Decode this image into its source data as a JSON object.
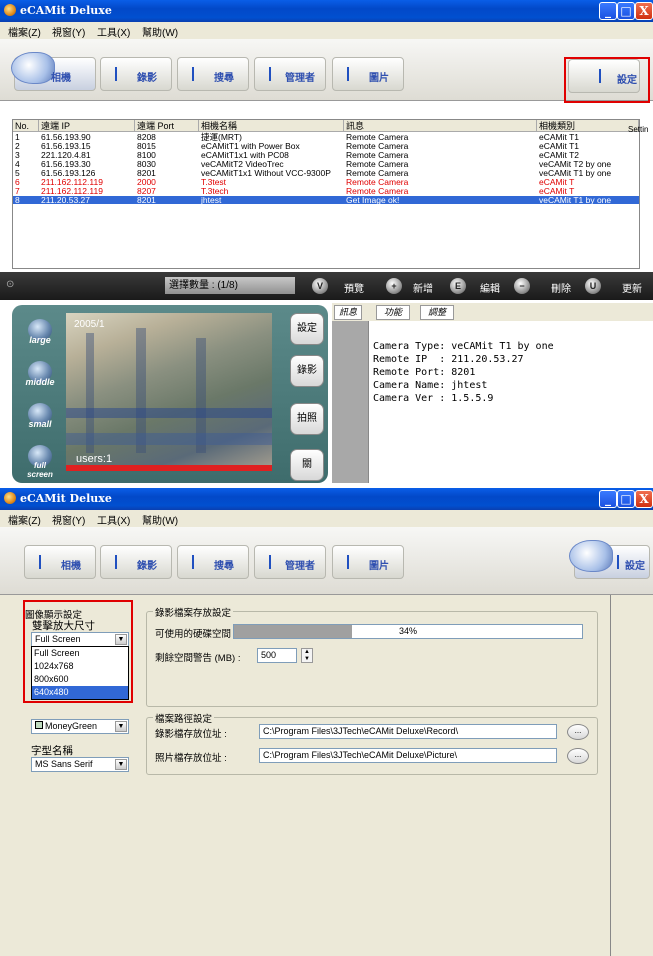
{
  "window_top": {
    "title": "eCAMit Deluxe",
    "buttons": [
      "_",
      "□",
      "X"
    ],
    "menu": [
      "檔案(Z)",
      "視窗(Y)",
      "工具(X)",
      "幫助(W)"
    ],
    "tabs": [
      "相機",
      "錄影",
      "搜尋",
      "管理者",
      "圖片"
    ],
    "settings_label": "設定",
    "settings_overflow": "Settin",
    "columns": [
      "No.",
      "遠端 IP",
      "遠端 Port",
      "相機名稱",
      "訊息",
      "相機類別"
    ],
    "rows": [
      {
        "no": "1",
        "ip": "61.56.193.90",
        "port": "8208",
        "name": "捷運(MRT)",
        "msg": "Remote Camera",
        "type": "eCAMit T1"
      },
      {
        "no": "2",
        "ip": "61.56.193.15",
        "port": "8015",
        "name": "eCAMitT1 with Power Box",
        "msg": "Remote Camera",
        "type": "eCAMit T1"
      },
      {
        "no": "3",
        "ip": "221.120.4.81",
        "port": "8100",
        "name": "eCAMitT1x1 with PC08",
        "msg": "Remote Camera",
        "type": "eCAMit T2"
      },
      {
        "no": "4",
        "ip": "61.56.193.30",
        "port": "8030",
        "name": "veCAMitT2 VideoTrec",
        "msg": "Remote Camera",
        "type": "veCAMit T2 by one"
      },
      {
        "no": "5",
        "ip": "61.56.193.126",
        "port": "8201",
        "name": "veCAMitT1x1 Without VCC-9300P",
        "msg": "Remote Camera",
        "type": "veCAMit T1 by one"
      },
      {
        "no": "6",
        "ip": "211.162.112.119",
        "port": "2000",
        "name": "T.3test",
        "msg": "Remote Camera",
        "type": "eCAMit T"
      },
      {
        "no": "7",
        "ip": "211.162.112.119",
        "port": "8207",
        "name": "T.3tech",
        "msg": "Remote Camera",
        "type": "eCAMit T"
      },
      {
        "no": "8",
        "ip": "211.20.53.27",
        "port": "8201",
        "name": "jhtest",
        "msg": "Get Image ok!",
        "type": "veCAMit T1 by one"
      }
    ],
    "red_rows": [
      6,
      7
    ],
    "selected_row": 8,
    "count_label": "選擇數量 : (1/8)",
    "actions": [
      {
        "icon": "V",
        "label": "預覽"
      },
      {
        "icon": "+",
        "label": "新增"
      },
      {
        "icon": "E",
        "label": "編輯"
      },
      {
        "icon": "−",
        "label": "刪除"
      },
      {
        "icon": "U",
        "label": "更新"
      }
    ],
    "size_buttons": [
      "large",
      "middle",
      "small",
      "full screen"
    ],
    "video_timestamp": "2005/1",
    "video_user": "users:1",
    "preview_buttons": [
      "設定",
      "錄影",
      "拍照",
      "關"
    ],
    "info_tabs": [
      "訊息",
      "功能",
      "調整"
    ],
    "info_lines": [
      "Camera Type: veCAMit T1 by one",
      "Remote IP  : 211.20.53.27",
      "Remote Port: 8201",
      "Camera Name: jhtest",
      "Camera Ver : 1.5.5.9"
    ]
  },
  "window_bottom": {
    "title": "eCAMit Deluxe",
    "menu": [
      "檔案(Z)",
      "視窗(Y)",
      "工具(X)",
      "幫助(W)"
    ],
    "tabs": [
      "相機",
      "錄影",
      "搜尋",
      "管理者",
      "圖片"
    ],
    "settings_label": "設定",
    "display_group": "圖像顯示設定",
    "zoom_label": "雙擊放大尺寸",
    "zoom_value": "Full Screen",
    "zoom_options": [
      "Full Screen",
      "1024x768",
      "800x600",
      "640x480"
    ],
    "highlighted_option": "640x480",
    "color_value": "MoneyGreen",
    "font_label": "字型名稱",
    "font_value": "MS Sans Serif",
    "record_group": "錄影檔案存放設定",
    "disk_label": "可使用的硬碟空間 :",
    "disk_percent_text": "34%",
    "disk_percent": 34,
    "warn_label": "剩餘空間警告 (MB) :",
    "warn_value": "500",
    "path_group": "檔案路徑設定",
    "record_path_label": "錄影檔存放位址 :",
    "record_path": "C:\\Program Files\\3JTech\\eCAMit Deluxe\\Record\\",
    "picture_path_label": "照片檔存放位址 :",
    "picture_path": "C:\\Program Files\\3JTech\\eCAMit Deluxe\\Picture\\",
    "browse_label": "..."
  },
  "colors": {
    "titlebar": "#0248c8",
    "selection": "#3168d6",
    "error_row": "#e00000",
    "highlight_box": "#e00000"
  }
}
